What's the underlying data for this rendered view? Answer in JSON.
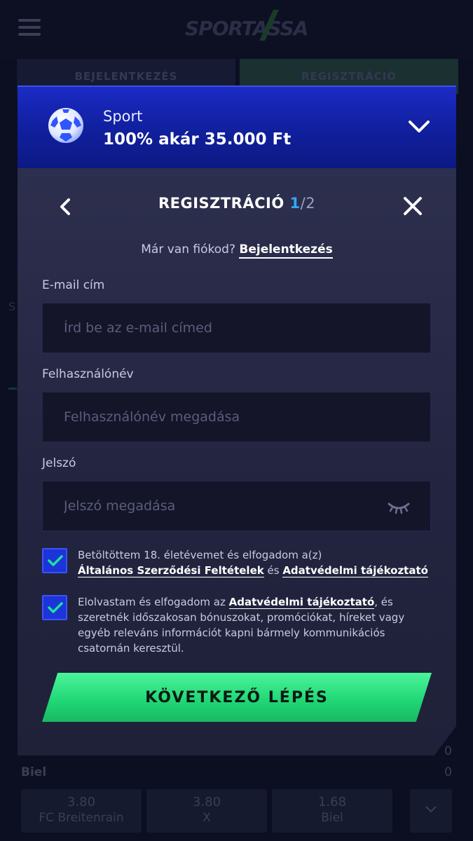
{
  "header": {
    "logo_text": "SPORTASSA"
  },
  "bg_tabs": {
    "login": "BEJELENTKEZÉS",
    "register": "REGISZTRÁCIÓ"
  },
  "bg_page": {
    "side_letter": "S",
    "team": "Biel",
    "score_top": "0",
    "score_bottom": "0",
    "odds": [
      {
        "value": "3.80",
        "label": "FC Breitenrain"
      },
      {
        "value": "3.80",
        "label": "X"
      },
      {
        "value": "1.68",
        "label": "Biel"
      }
    ]
  },
  "promo": {
    "category": "Sport",
    "offer": "100% akár 35.000 Ft",
    "icon": "soccer-ball-icon"
  },
  "modal": {
    "title": "REGISZTRÁCIÓ",
    "step_current": "1",
    "step_total": "/2",
    "have_account_text": "Már van fiókod?",
    "login_link": "Bejelentkezés"
  },
  "form": {
    "email_label": "E-mail cím",
    "email_placeholder": "Írd be az e-mail címed",
    "username_label": "Felhasználónév",
    "username_placeholder": "Felhasználónév megadása",
    "password_label": "Jelszó",
    "password_placeholder": "Jelszó megadása"
  },
  "consents": {
    "age": {
      "checked": true,
      "text_before": "Betöltöttem 18. életévemet és elfogadom a(z)",
      "link1": "Általános Szerződési Feltételek",
      "middle": "és",
      "link2": "Adatvédelmi tájékoztató"
    },
    "marketing": {
      "checked": true,
      "text_before": "Elolvastam és elfogadom az",
      "link": "Adatvédelmi tájékoztató",
      "text_after": ", és szeretnék időszakosan bónuszokat, promóciókat, híreket vagy egyéb releváns információt kapni bármely kommunikációs csatornán keresztül."
    }
  },
  "next_button": "KÖVETKEZŐ LÉPÉS",
  "colors": {
    "accent_blue": "#2ea9ff",
    "cta_green": "#21d877",
    "checkbox_blue": "#1c34d8"
  }
}
